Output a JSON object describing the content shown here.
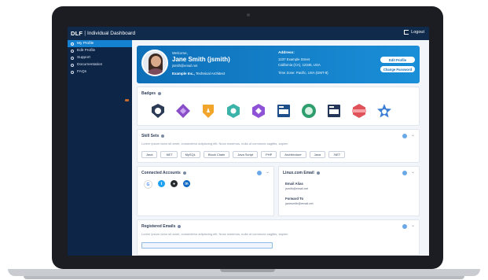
{
  "app": {
    "brand": "DLF",
    "title": "Individual Dashboard",
    "logout_label": "Logout"
  },
  "sidebar": {
    "items": [
      {
        "label": "My Profile",
        "icon": "user-icon"
      },
      {
        "label": "Edit Profile",
        "icon": "pencil-icon"
      },
      {
        "label": "Support",
        "icon": "headset-icon"
      },
      {
        "label": "Documentation",
        "icon": "book-icon"
      },
      {
        "label": "FAQs",
        "icon": "question-icon"
      }
    ]
  },
  "profile": {
    "welcome": "Welcome,",
    "name": "Jane Smith (jsmith)",
    "email": "jsmith@email.net",
    "company": "Example Inc.,",
    "role": "Technical Architect",
    "address_label": "Address:",
    "address_line1": "1237 Example Street",
    "address_line2": "California (CA), 12345, USA",
    "timezone": "Time Zone: Pacific, USA (GMT-8)",
    "edit_button": "Edit Profile",
    "password_button": "Change Password"
  },
  "badges": {
    "title": "Badges"
  },
  "skills": {
    "title": "Skill Sets",
    "description": "Lorem ipsum dolor sit amet, consectetur adipiscing elit. Nunc maximus, nulla ut commodo sagittis, sapien",
    "items": [
      "Java",
      ".NET",
      "MySQL",
      "Block Chain",
      "Java Script",
      "PHP",
      "Architecture",
      "Java",
      ".NET"
    ]
  },
  "connected": {
    "title": "Connected Accounts"
  },
  "linux_email": {
    "title": "Linux.com Email",
    "alias_label": "Email Alias",
    "alias_value": "jsmith@email.net",
    "forward_label": "Forward To",
    "forward_value": "janesmith@email.net"
  },
  "registered": {
    "title": "Registered Emails",
    "description": "Lorem ipsum dolor sit amet, consectetur adipiscing elit. Nunc maximus, nulla ut commodo sagittis, sapien"
  },
  "colors": {
    "primary": "#1581d1",
    "sidebar": "#0d2547",
    "topbar": "#0f2a4a"
  }
}
